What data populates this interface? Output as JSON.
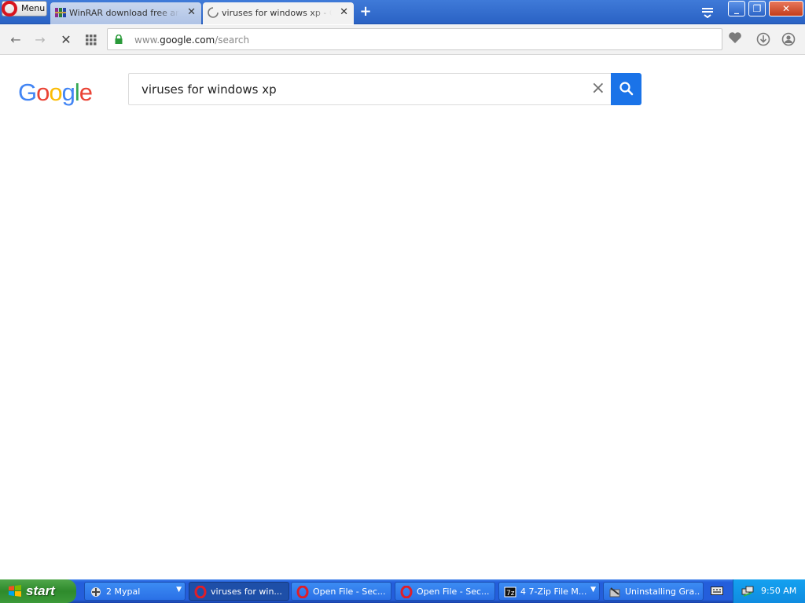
{
  "browser": {
    "menu_label": "Menu",
    "tabs": [
      {
        "title": "WinRAR download free and …",
        "state": "inactive",
        "icon": "winrar-icon"
      },
      {
        "title": "viruses for windows xp - Goo…",
        "state": "active",
        "icon": "loading-spinner-icon"
      }
    ],
    "new_tab_symbol": "+",
    "address": {
      "prefix": "www.",
      "host": "google.com",
      "path": "/search"
    }
  },
  "google": {
    "logo_letters": [
      "G",
      "o",
      "o",
      "g",
      "l",
      "e"
    ],
    "query": "viruses for windows xp",
    "clear_symbol": "×"
  },
  "taskbar": {
    "start_label": "start",
    "items": [
      {
        "label": "2 Mypal",
        "icon": "mypal-icon",
        "group": true
      },
      {
        "label": "viruses for win...",
        "icon": "opera-icon",
        "active": true
      },
      {
        "label": "Open File - Sec...",
        "icon": "opera-icon"
      },
      {
        "label": "Open File - Sec...",
        "icon": "opera-icon"
      },
      {
        "label": "4  7-Zip File M...",
        "icon": "7zip-icon",
        "group": true
      },
      {
        "label": "Uninstalling Gra...",
        "icon": "uninstall-icon"
      }
    ],
    "clock": "9:50 AM"
  },
  "colors": {
    "google_blue": "#4285f4",
    "search_button": "#1a73e8",
    "opera_red": "#d8151f",
    "xp_taskbar": "#245edb",
    "xp_start": "#3c9a39"
  }
}
